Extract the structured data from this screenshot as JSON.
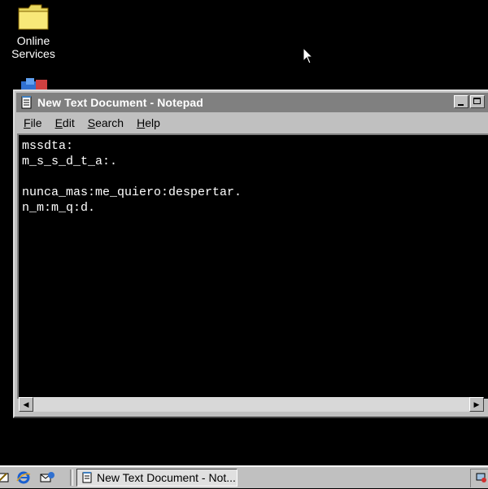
{
  "desktop": {
    "icons": [
      {
        "label_line1": "Online",
        "label_line2": "Services",
        "icon": "folder-icon"
      },
      {
        "icon": "setup-icon"
      }
    ]
  },
  "window": {
    "title": "New Text Document - Notepad",
    "app_icon": "notepad-icon",
    "menu": [
      "File",
      "Edit",
      "Search",
      "Help"
    ],
    "content_lines": [
      "mssdta:",
      "m_s_s_d_t_a:.",
      "",
      "nunca_mas:me_quiero:despertar.",
      "n_m:m_q:d."
    ]
  },
  "taskbar": {
    "quick_launch": [
      "desktop-icon",
      "internet-explorer-icon",
      "outlook-icon"
    ],
    "task_button_label": "New Text Document - Not...",
    "task_button_icon": "notepad-icon"
  },
  "colors": {
    "desktop_bg": "#000000",
    "inactive_title_bg": "#808080",
    "chrome": "#c0c0c0",
    "editor_bg": "#000000",
    "editor_text": "#ffffff"
  }
}
